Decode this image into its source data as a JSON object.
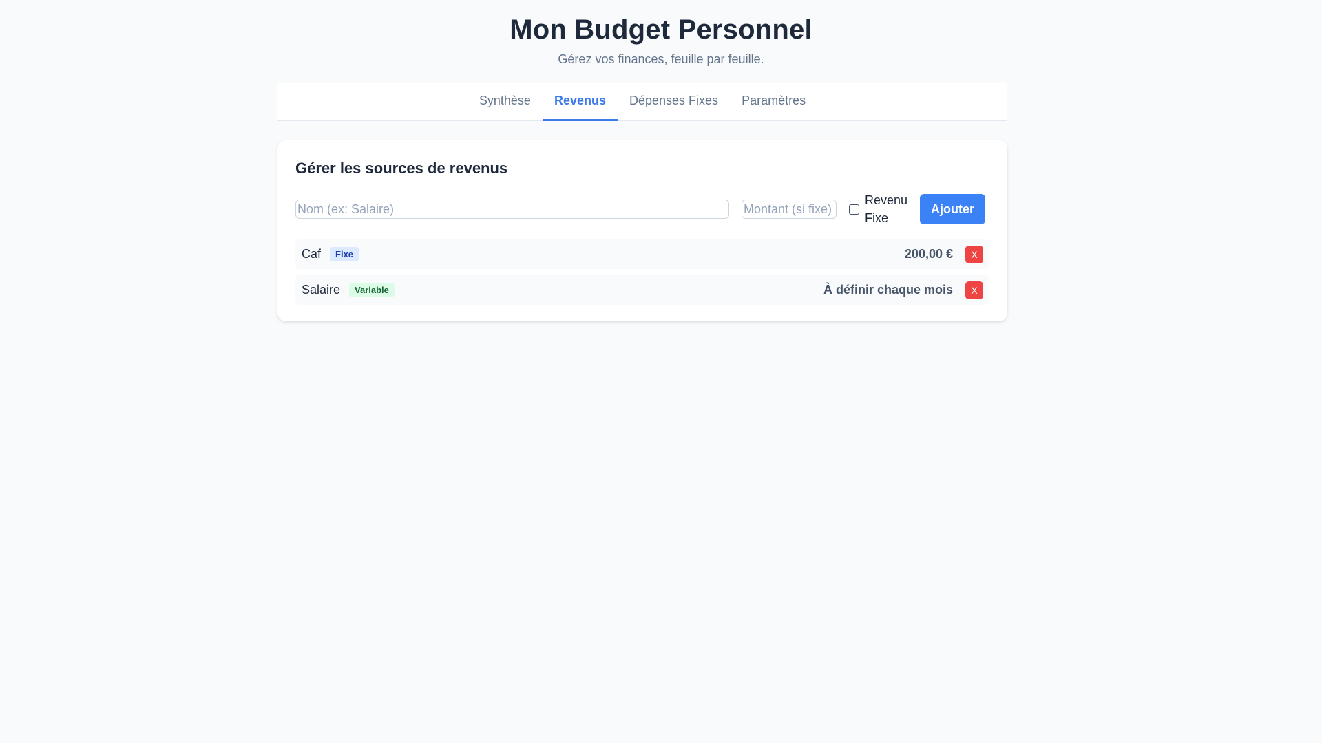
{
  "header": {
    "title": "Mon Budget Personnel",
    "subtitle": "Gérez vos finances, feuille par feuille."
  },
  "tabs": [
    {
      "label": "Synthèse",
      "active": false
    },
    {
      "label": "Revenus",
      "active": true
    },
    {
      "label": "Dépenses Fixes",
      "active": false
    },
    {
      "label": "Paramètres",
      "active": false
    }
  ],
  "card": {
    "title": "Gérer les sources de revenus",
    "form": {
      "name_placeholder": "Nom (ex: Salaire)",
      "name_value": "",
      "amount_placeholder": "Montant (si fixe)",
      "amount_value": "",
      "fixed_label": "Revenu Fixe",
      "fixed_checked": false,
      "add_label": "Ajouter"
    },
    "incomes": [
      {
        "name": "Caf",
        "badge": "Fixe",
        "amount": "200,00 €",
        "delete_label": "X"
      },
      {
        "name": "Salaire",
        "badge": "Variable",
        "amount": "À définir chaque mois",
        "delete_label": "X"
      }
    ]
  },
  "colors": {
    "accent": "#3b82f6",
    "danger": "#ef4444",
    "background": "#f8fafc"
  }
}
